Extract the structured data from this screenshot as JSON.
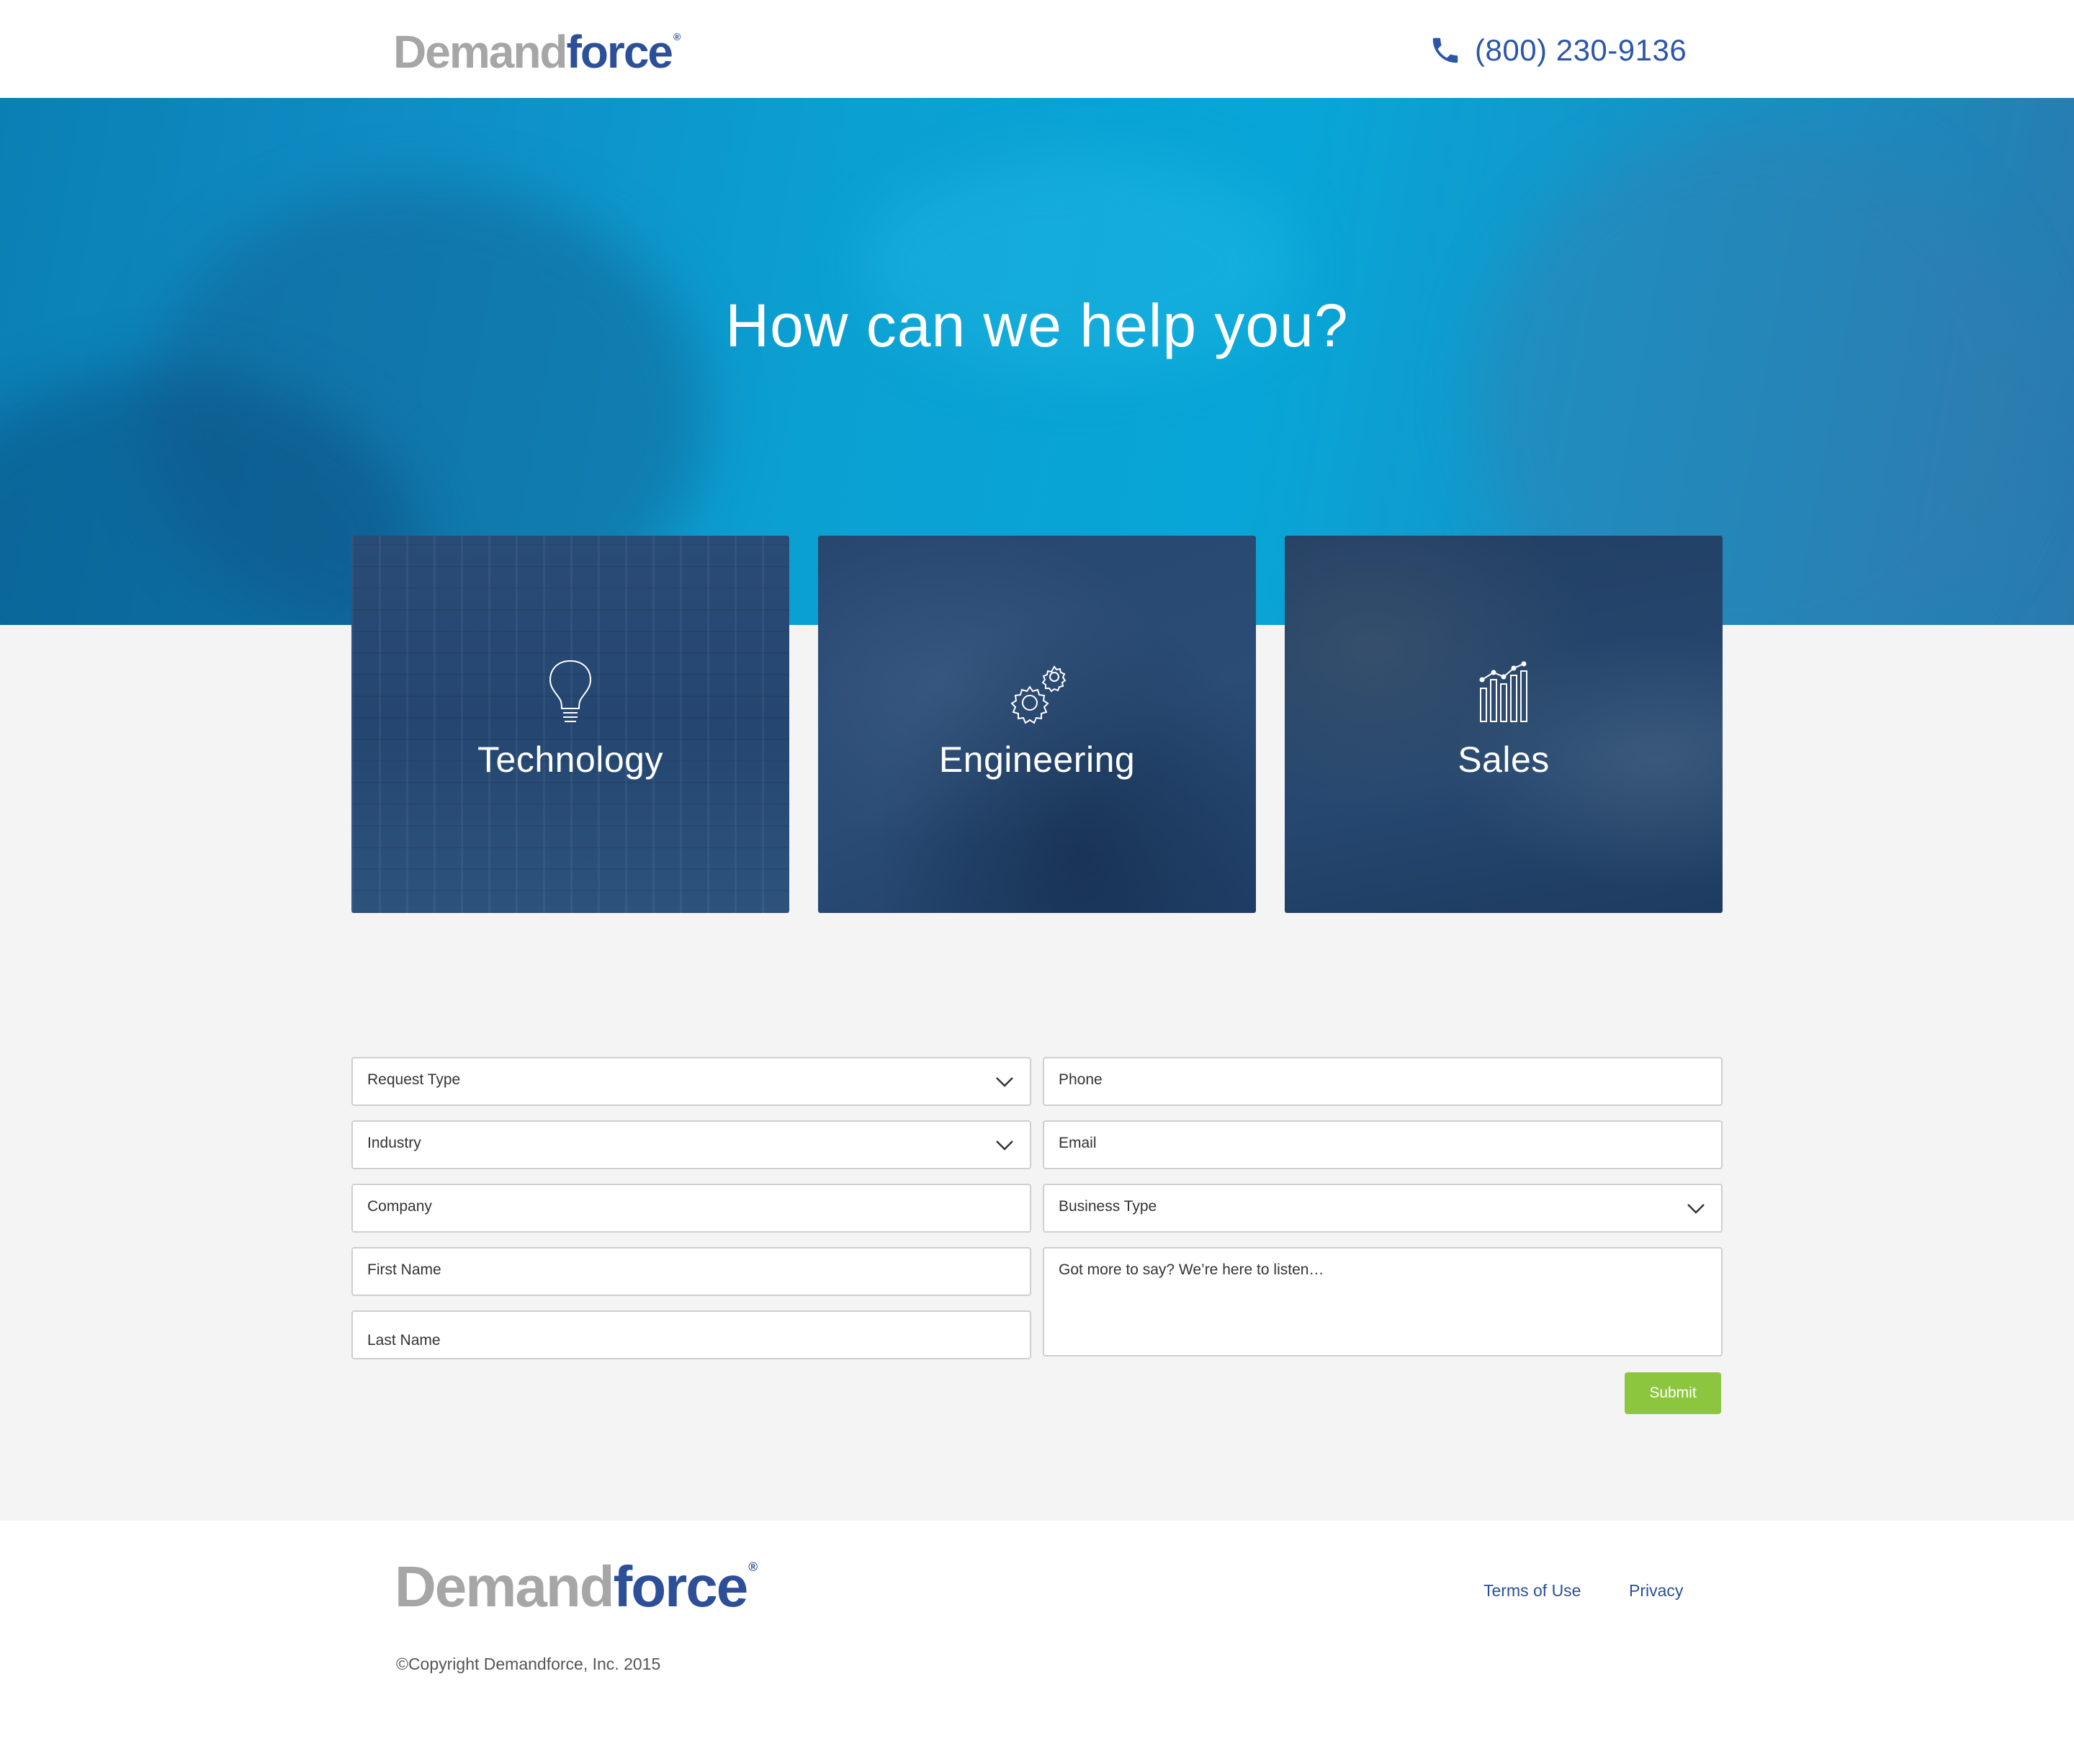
{
  "header": {
    "logo": {
      "part1": "Demand",
      "part2": "force",
      "mark": "®"
    },
    "phone_icon": "phone-icon",
    "phone": "(800) 230-9136"
  },
  "hero": {
    "title": "How can we help you?"
  },
  "cards": [
    {
      "label": "Technology",
      "icon": "lightbulb-icon"
    },
    {
      "label": "Engineering",
      "icon": "gears-icon"
    },
    {
      "label": "Sales",
      "icon": "bar-chart-icon"
    }
  ],
  "form": {
    "request_type": "Request Type",
    "industry": "Industry",
    "company": "Company",
    "first_name": "First Name",
    "last_name": "Last Name",
    "phone": "Phone",
    "email": "Email",
    "business_type": "Business Type",
    "message": "Got more to say?  We’re here to listen…",
    "submit": "Submit"
  },
  "footer": {
    "logo": {
      "part1": "Demand",
      "part2": "force",
      "mark": "®"
    },
    "terms": "Terms of Use",
    "privacy": "Privacy",
    "copyright": "©Copyright Demandforce, Inc. 2015"
  },
  "colors": {
    "brand_blue": "#2c4f98",
    "hero_blue": "#08a6d8",
    "card_navy": "#1f4873",
    "submit_green": "#8cc63f"
  }
}
